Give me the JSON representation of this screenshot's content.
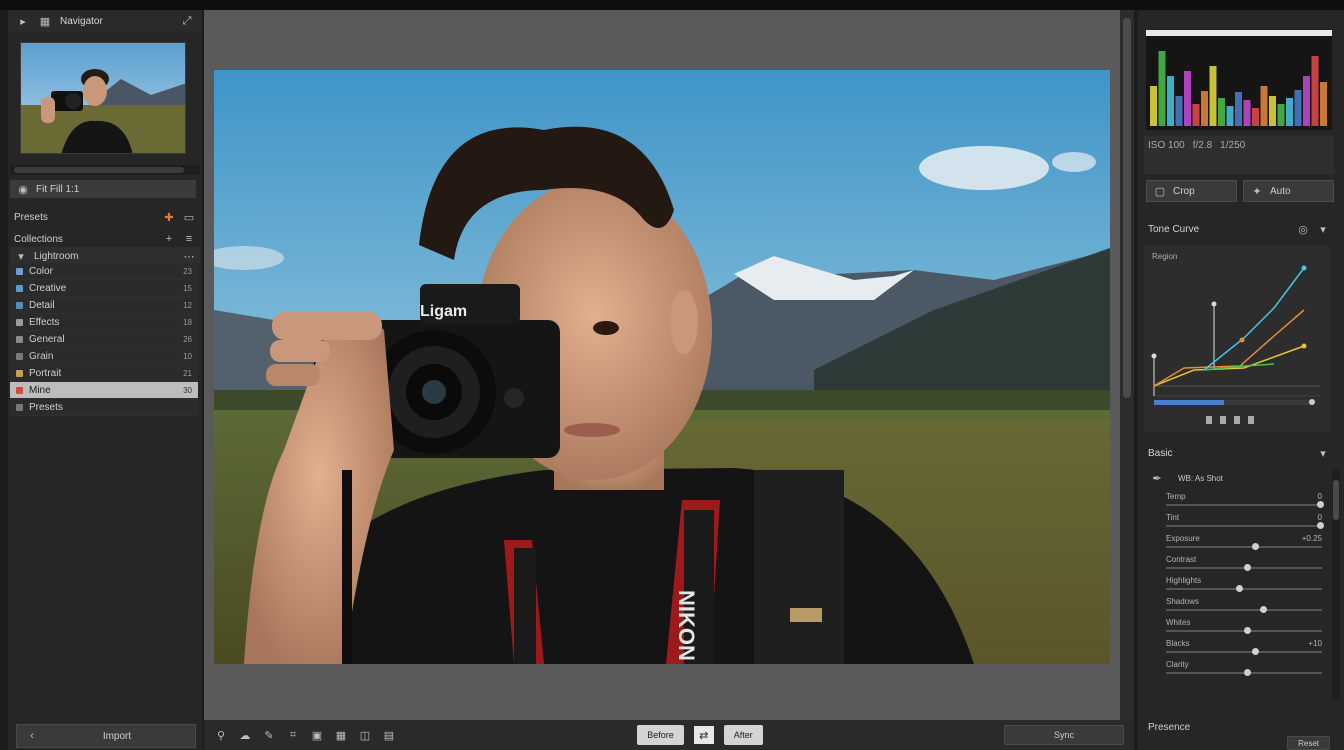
{
  "left_panel": {
    "header_title": "Navigator",
    "preset_row_label": "Fit Fill 1:1",
    "collections_header": "Collections",
    "presets_header": "Presets",
    "presets_sub": "Lightroom",
    "collections": [
      {
        "label": "Color",
        "count": "23",
        "color": "#6aa0d8"
      },
      {
        "label": "Creative",
        "count": "15",
        "color": "#5a9bd5"
      },
      {
        "label": "Detail",
        "count": "12",
        "color": "#4f8fc7"
      },
      {
        "label": "Effects",
        "count": "18",
        "color": "#9a9a9a"
      },
      {
        "label": "General",
        "count": "26",
        "color": "#8a8a8a"
      },
      {
        "label": "Grain",
        "count": "10",
        "color": "#7a7a7a"
      },
      {
        "label": "Portrait",
        "count": "21",
        "color": "#c8a050"
      },
      {
        "label": "Mine",
        "count": "30",
        "color": "#d84a3a"
      },
      {
        "label": "Presets",
        "count": "",
        "color": "#777777"
      }
    ],
    "bottom_button": "Import"
  },
  "toolbar": {
    "btn_before": "Before",
    "btn_after": "After",
    "btn_right": "Sync"
  },
  "right_panel": {
    "histo_info": [
      "ISO 100",
      "f/2.8",
      "1/250"
    ],
    "btn_left": "Crop",
    "btn_right": "Auto",
    "tone_curve_header": "Tone Curve",
    "tone_curve_sub": "Region",
    "basic_header": "Basic",
    "basic_sub": "WB: As Shot",
    "sliders": [
      {
        "label": "Temp",
        "value": "0",
        "pos": 0.97
      },
      {
        "label": "Tint",
        "value": "0",
        "pos": 0.97
      },
      {
        "label": "Exposure",
        "value": "+0.25",
        "pos": 0.55
      },
      {
        "label": "Contrast",
        "value": "",
        "pos": 0.5
      },
      {
        "label": "Highlights",
        "value": "",
        "pos": 0.45
      },
      {
        "label": "Shadows",
        "value": "",
        "pos": 0.6
      },
      {
        "label": "Whites",
        "value": "",
        "pos": 0.5
      },
      {
        "label": "Blacks",
        "value": "+10",
        "pos": 0.55
      },
      {
        "label": "Clarity",
        "value": "",
        "pos": 0.5
      }
    ],
    "footer_label": "Presence",
    "footer_btn": "Reset"
  },
  "photo": {
    "camera_brand": "Ligam",
    "strap_text": "NIKON"
  },
  "colors": {
    "accent": "#4d7fd1",
    "curve_cyan": "#47c7e8",
    "curve_yellow": "#e8c23a",
    "curve_green": "#49c24a",
    "curve_orange": "#e88a3a"
  }
}
